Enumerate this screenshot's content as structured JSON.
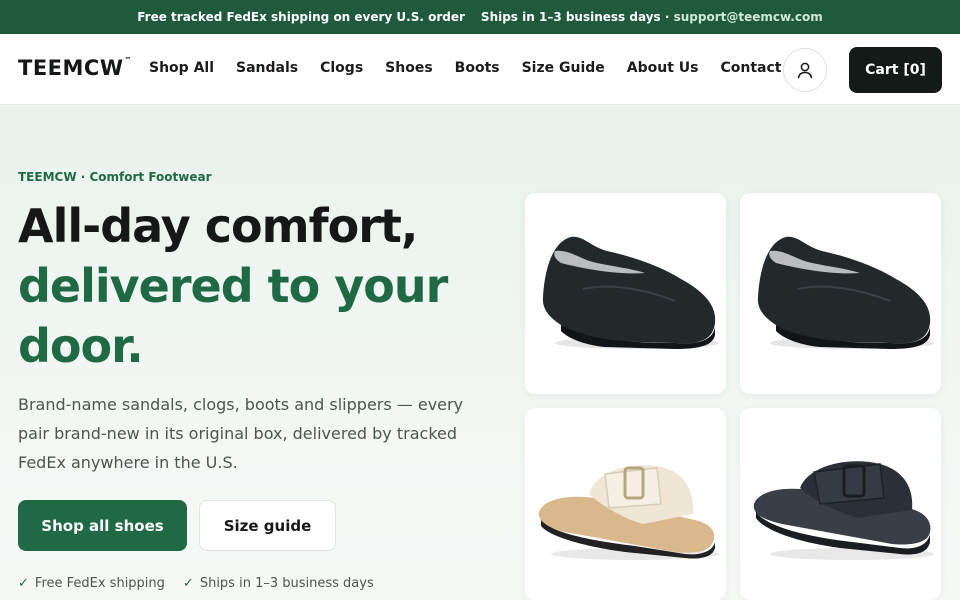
{
  "announcement": {
    "shipping": "Free tracked FedEx shipping on every U.S. order",
    "ships": "Ships in 1–3 business days ·",
    "email": "support@teemcw.com"
  },
  "header": {
    "logo": "TEEMCW",
    "logo_mark": "™",
    "nav": [
      "Shop All",
      "Sandals",
      "Clogs",
      "Shoes",
      "Boots",
      "Size Guide",
      "About Us",
      "Contact"
    ],
    "account_icon": "user-icon",
    "cart_label": "Cart [0]"
  },
  "hero": {
    "eyebrow": "TEEMCW · Comfort Footwear",
    "headline_line1": "All-day comfort,",
    "headline_line2": "delivered to your door.",
    "description": "Brand-name sandals, clogs, boots and slippers — every pair brand-new in its original box, delivered by tracked FedEx anywhere in the U.S.",
    "primary_cta": "Shop all shoes",
    "secondary_cta": "Size guide",
    "perks": [
      {
        "icon": "✓",
        "text": "Free FedEx shipping"
      },
      {
        "icon": "✓",
        "text": "Ships in 1–3 business days"
      }
    ]
  },
  "products": [
    {
      "name": "black-clog-image"
    },
    {
      "name": "black-clog-image"
    },
    {
      "name": "cream-cork-sandal-image"
    },
    {
      "name": "black-platform-sandal-image"
    }
  ],
  "colors": {
    "brand_green": "#1f6a44",
    "topbar": "#1e5a3b",
    "dark": "#141a17"
  }
}
